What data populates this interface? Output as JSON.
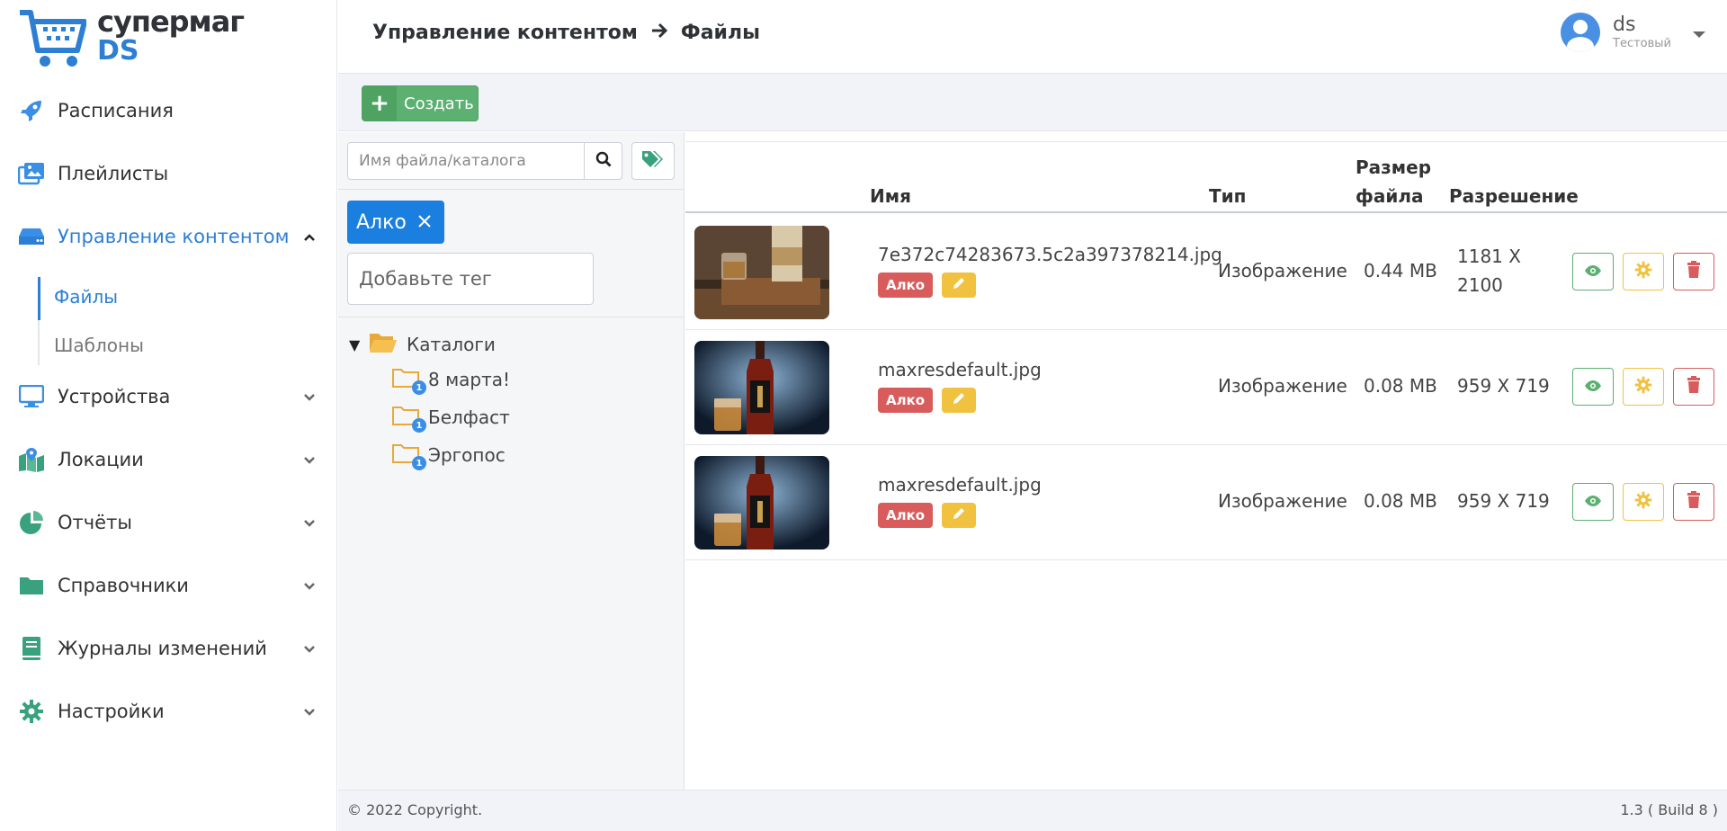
{
  "logo": {
    "line1": "супермаг",
    "line2": "DS"
  },
  "sidebar": {
    "items": [
      {
        "label": "Расписания"
      },
      {
        "label": "Плейлисты"
      },
      {
        "label": "Управление контентом"
      },
      {
        "label": "Устройства"
      },
      {
        "label": "Локации"
      },
      {
        "label": "Отчёты"
      },
      {
        "label": "Справочники"
      },
      {
        "label": "Журналы изменений"
      },
      {
        "label": "Настройки"
      }
    ],
    "submenu": [
      {
        "label": "Файлы"
      },
      {
        "label": "Шаблоны"
      }
    ]
  },
  "header": {
    "breadcrumb": {
      "parent": "Управление контентом",
      "current": "Файлы"
    },
    "user": {
      "name": "ds",
      "role": "Тестовый"
    }
  },
  "toolbar": {
    "create_label": "Создать"
  },
  "filter": {
    "search_placeholder": "Имя файла/каталога",
    "active_tag": "Алко",
    "tag_input_placeholder": "Добавьте тег"
  },
  "tree": {
    "root": "Каталоги",
    "nodes": [
      {
        "label": "8 марта!",
        "badge": "1"
      },
      {
        "label": "Белфаст",
        "badge": "1"
      },
      {
        "label": "Эргопос",
        "badge": "1"
      }
    ]
  },
  "table": {
    "headers": {
      "name": "Имя",
      "type": "Тип",
      "size_line1": "Размер",
      "size_line2": "файла",
      "resolution": "Разрешение"
    },
    "rows": [
      {
        "name": "7e372c74283673.5c2a397378214.jpg",
        "tag": "Алко",
        "type": "Изображение",
        "size": "0.44 MB",
        "res_line1": "1181 X",
        "res_line2": "2100"
      },
      {
        "name": "maxresdefault.jpg",
        "tag": "Алко",
        "type": "Изображение",
        "size": "0.08 MB",
        "res_line1": "959 X 719",
        "res_line2": ""
      },
      {
        "name": "maxresdefault.jpg",
        "tag": "Алко",
        "type": "Изображение",
        "size": "0.08 MB",
        "res_line1": "959 X 719",
        "res_line2": ""
      }
    ]
  },
  "footer": {
    "copyright": "© 2022 Copyright.",
    "version": "1.3 ( Build 8 )"
  },
  "colors": {
    "accent": "#2d7fd4",
    "sidebar_icon": "#3aa17e",
    "success": "#5cb071",
    "warning": "#f0c23f",
    "danger": "#d85c5c",
    "tag_active": "#1b7fe0"
  },
  "icons": [
    "cart-logo-icon",
    "rocket-icon",
    "images-icon",
    "drive-icon",
    "monitor-icon",
    "map-icon",
    "pie-chart-icon",
    "folder-icon",
    "book-icon",
    "gear-icon",
    "chevron-down-icon",
    "chevron-up-icon",
    "arrow-right-icon",
    "user-avatar-icon",
    "plus-icon",
    "search-icon",
    "tags-icon",
    "close-icon",
    "folder-open-icon",
    "pencil-icon",
    "eye-icon",
    "trash-icon"
  ]
}
